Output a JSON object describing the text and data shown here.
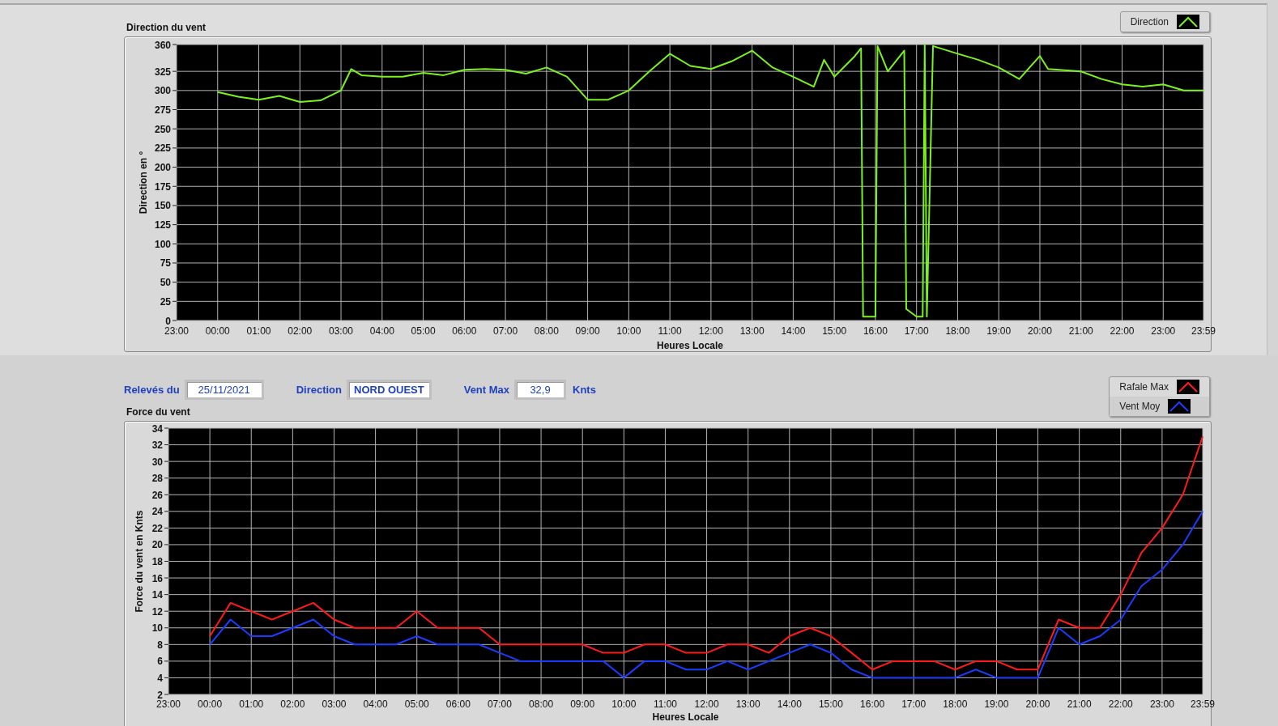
{
  "direction_panel": {
    "chart_data": {
      "type": "line",
      "grid": true,
      "title": "Direction du vent",
      "xlabel": "Heures Locale",
      "ylabel": "Direction en °",
      "xlim": [
        -1,
        23.98
      ],
      "ylim": [
        0,
        360
      ],
      "xticks": [
        {
          "value": 0,
          "label": "00:00"
        },
        {
          "value": 1,
          "label": "01:00"
        },
        {
          "value": 2,
          "label": "02:00"
        },
        {
          "value": 3,
          "label": "03:00"
        },
        {
          "value": 4,
          "label": "04:00"
        },
        {
          "value": 5,
          "label": "05:00"
        },
        {
          "value": 6,
          "label": "06:00"
        },
        {
          "value": 7,
          "label": "07:00"
        },
        {
          "value": 8,
          "label": "08:00"
        },
        {
          "value": 9,
          "label": "09:00"
        },
        {
          "value": 10,
          "label": "10:00"
        },
        {
          "value": 11,
          "label": "11:00"
        },
        {
          "value": 12,
          "label": "12:00"
        },
        {
          "value": 13,
          "label": "13:00"
        },
        {
          "value": 14,
          "label": "14:00"
        },
        {
          "value": 15,
          "label": "15:00"
        },
        {
          "value": 16,
          "label": "16:00"
        },
        {
          "value": 17,
          "label": "17:00"
        },
        {
          "value": 18,
          "label": "18:00"
        },
        {
          "value": 19,
          "label": "19:00"
        },
        {
          "value": 20,
          "label": "20:00"
        },
        {
          "value": 21,
          "label": "21:00"
        },
        {
          "value": 22,
          "label": "22:00"
        },
        {
          "value": 23,
          "label": "23:00"
        },
        {
          "value": 23.98,
          "label": "23:59"
        }
      ],
      "yticks": [
        0,
        25,
        50,
        75,
        100,
        125,
        150,
        175,
        200,
        225,
        250,
        275,
        300,
        325,
        360
      ],
      "x": [
        0,
        0.5,
        1,
        1.5,
        2,
        2.5,
        3,
        3.25,
        3.5,
        4,
        4.5,
        5,
        5.5,
        6,
        6.5,
        7,
        7.5,
        8,
        8.5,
        9,
        9.5,
        10,
        10.5,
        11,
        11.5,
        12,
        12.5,
        13,
        13.5,
        14,
        14.5,
        14.75,
        15,
        15.5,
        15.65,
        15.7,
        16,
        16.05,
        16.3,
        16.7,
        16.75,
        17,
        17.15,
        17.2,
        17.25,
        17.4,
        18,
        18.5,
        19,
        19.5,
        20,
        20.2,
        21,
        21.5,
        22,
        22.5,
        23,
        23.5,
        23.98
      ],
      "series": [
        {
          "name": "Direction",
          "color": "#7cf21c",
          "values": [
            298,
            292,
            288,
            293,
            285,
            287,
            300,
            328,
            320,
            318,
            318,
            323,
            320,
            327,
            328,
            327,
            322,
            330,
            318,
            288,
            288,
            300,
            325,
            348,
            332,
            328,
            338,
            352,
            330,
            318,
            305,
            340,
            318,
            345,
            355,
            5,
            5,
            358,
            325,
            352,
            15,
            5,
            5,
            360,
            5,
            358,
            348,
            340,
            330,
            315,
            345,
            328,
            325,
            315,
            308,
            305,
            308,
            300,
            300
          ]
        }
      ]
    },
    "axis_start_label": "23:00"
  },
  "readings": {
    "date_label": "Relevés du",
    "date": "25/11/2021",
    "direction_label": "Direction",
    "direction": "NORD OUEST",
    "max_label": "Vent Max",
    "max": "32,9",
    "max_unit": "Knts"
  },
  "force_panel": {
    "chart_data": {
      "type": "line",
      "grid": true,
      "title": "Force du vent",
      "xlabel": "Heures Locale",
      "ylabel": "Force du vent en Knts",
      "xlim": [
        -1,
        23.98
      ],
      "ylim": [
        2,
        34
      ],
      "xticks": [
        {
          "value": 0,
          "label": "00:00"
        },
        {
          "value": 1,
          "label": "01:00"
        },
        {
          "value": 2,
          "label": "02:00"
        },
        {
          "value": 3,
          "label": "03:00"
        },
        {
          "value": 4,
          "label": "04:00"
        },
        {
          "value": 5,
          "label": "05:00"
        },
        {
          "value": 6,
          "label": "06:00"
        },
        {
          "value": 7,
          "label": "07:00"
        },
        {
          "value": 8,
          "label": "08:00"
        },
        {
          "value": 9,
          "label": "09:00"
        },
        {
          "value": 10,
          "label": "10:00"
        },
        {
          "value": 11,
          "label": "11:00"
        },
        {
          "value": 12,
          "label": "12:00"
        },
        {
          "value": 13,
          "label": "13:00"
        },
        {
          "value": 14,
          "label": "14:00"
        },
        {
          "value": 15,
          "label": "15:00"
        },
        {
          "value": 16,
          "label": "16:00"
        },
        {
          "value": 17,
          "label": "17:00"
        },
        {
          "value": 18,
          "label": "18:00"
        },
        {
          "value": 19,
          "label": "19:00"
        },
        {
          "value": 20,
          "label": "20:00"
        },
        {
          "value": 21,
          "label": "21:00"
        },
        {
          "value": 22,
          "label": "22:00"
        },
        {
          "value": 23,
          "label": "23:00"
        },
        {
          "value": 23.98,
          "label": "23:59"
        }
      ],
      "yticks": [
        2,
        4,
        6,
        8,
        10,
        12,
        14,
        16,
        18,
        20,
        22,
        24,
        26,
        28,
        30,
        32,
        34
      ],
      "x": [
        0,
        0.5,
        1,
        1.5,
        2,
        2.5,
        3,
        3.5,
        4,
        4.5,
        5,
        5.5,
        6,
        6.5,
        7,
        7.5,
        8,
        8.5,
        9,
        9.5,
        10,
        10.5,
        11,
        11.5,
        12,
        12.5,
        13,
        13.5,
        14,
        14.5,
        15,
        15.5,
        16,
        16.5,
        17,
        17.5,
        18,
        18.5,
        19,
        19.5,
        20,
        20.5,
        21,
        21.5,
        22,
        22.5,
        23,
        23.5,
        23.98
      ],
      "series": [
        {
          "name": "Rafale Max",
          "color": "#ff1a1a",
          "values": [
            9,
            13,
            12,
            11,
            12,
            13,
            11,
            10,
            10,
            10,
            12,
            10,
            10,
            10,
            8,
            8,
            8,
            8,
            8,
            7,
            7,
            8,
            8,
            7,
            7,
            8,
            8,
            7,
            9,
            10,
            9,
            7,
            5,
            6,
            6,
            6,
            5,
            6,
            6,
            5,
            5,
            11,
            10,
            10,
            14,
            19,
            22,
            26,
            33
          ]
        },
        {
          "name": "Vent Moy",
          "color": "#1a3cff",
          "values": [
            8,
            11,
            9,
            9,
            10,
            11,
            9,
            8,
            8,
            8,
            9,
            8,
            8,
            8,
            7,
            6,
            6,
            6,
            6,
            6,
            4,
            6,
            6,
            5,
            5,
            6,
            5,
            6,
            7,
            8,
            7,
            5,
            4,
            4,
            4,
            4,
            4,
            5,
            4,
            4,
            4,
            10,
            8,
            9,
            11,
            15,
            17,
            20,
            24
          ]
        }
      ]
    },
    "axis_start_label": "23:00"
  }
}
